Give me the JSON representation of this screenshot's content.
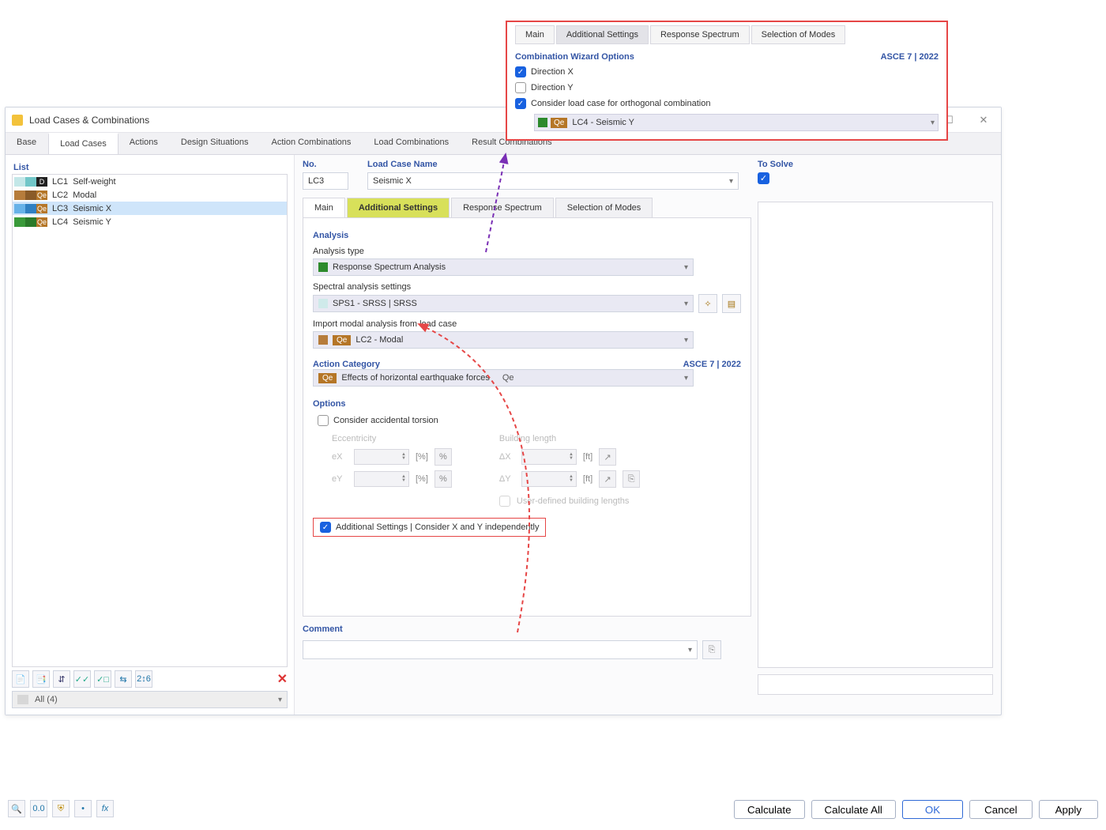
{
  "dialog_title": "Load Cases & Combinations",
  "callout": {
    "tabs": [
      "Main",
      "Additional Settings",
      "Response Spectrum",
      "Selection of Modes"
    ],
    "active_tab": "Additional Settings",
    "section_title": "Combination Wizard Options",
    "section_code": "ASCE 7 | 2022",
    "dir_x": "Direction X",
    "dir_y": "Direction Y",
    "orth_label": "Consider load case for orthogonal combination",
    "orth_value": "LC4 - Seismic Y",
    "orth_tag": "Qe"
  },
  "tabs": {
    "items": [
      "Base",
      "Load Cases",
      "Actions",
      "Design Situations",
      "Action Combinations",
      "Load Combinations",
      "Result Combinations"
    ],
    "active": "Load Cases"
  },
  "sidebar": {
    "header": "List",
    "rows": [
      {
        "code": "D",
        "id": "LC1",
        "name": "Self-weight"
      },
      {
        "code": "Qe",
        "id": "LC2",
        "name": "Modal"
      },
      {
        "code": "Qe",
        "id": "LC3",
        "name": "Seismic X",
        "selected": true
      },
      {
        "code": "Qe",
        "id": "LC4",
        "name": "Seismic Y"
      }
    ],
    "filter_label": "All (4)"
  },
  "form": {
    "no_label": "No.",
    "no_value": "LC3",
    "name_label": "Load Case Name",
    "name_value": "Seismic X",
    "tosolve": "To Solve",
    "tabs": [
      "Main",
      "Additional Settings",
      "Response Spectrum",
      "Selection of Modes"
    ],
    "analysis": {
      "section": "Analysis",
      "type_label": "Analysis type",
      "type_value": "Response Spectrum Analysis",
      "spectral_label": "Spectral analysis settings",
      "spectral_value": "SPS1 - SRSS | SRSS",
      "import_label": "Import modal analysis from load case",
      "import_value": "LC2 - Modal",
      "import_tag": "Qe"
    },
    "action_category": {
      "section": "Action Category",
      "code": "ASCE 7 | 2022",
      "value": "Effects of horizontal earthquake forces",
      "tag": "Qe",
      "suffix": "Qe"
    },
    "options": {
      "section": "Options",
      "torsion": "Consider accidental torsion",
      "ecc_header": "Eccentricity",
      "ex": "eX",
      "ey": "eY",
      "unit_pct": "[%]",
      "bl_header": "Building length",
      "dx": "ΔX",
      "dy": "ΔY",
      "unit_ft": "[ft]",
      "userdef": "User-defined building lengths",
      "redbox": "Additional Settings | Consider X and Y independently"
    },
    "comment": {
      "section": "Comment"
    }
  },
  "footer": {
    "calculate": "Calculate",
    "calc_all": "Calculate All",
    "ok": "OK",
    "cancel": "Cancel",
    "apply": "Apply"
  }
}
